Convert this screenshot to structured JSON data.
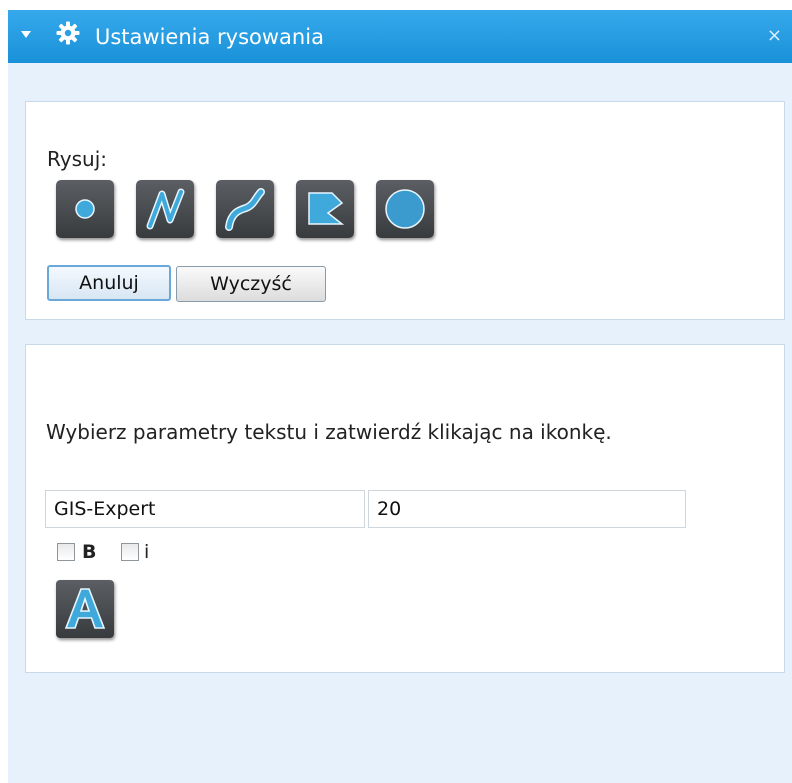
{
  "window": {
    "title": "Ustawienia rysowania",
    "close_label": "×",
    "icons": {
      "collapse": "triangle-down-icon",
      "gear": "gear-icon"
    }
  },
  "draw": {
    "label": "Rysuj:",
    "tools": [
      {
        "name": "point",
        "icon": "point-icon"
      },
      {
        "name": "polyline",
        "icon": "polyline-icon"
      },
      {
        "name": "freehand-line",
        "icon": "curve-icon"
      },
      {
        "name": "polygon",
        "icon": "polygon-icon"
      },
      {
        "name": "circle",
        "icon": "circle-icon"
      }
    ],
    "cancel_label": "Anuluj",
    "clear_label": "Wyczyść"
  },
  "text": {
    "instruction": "Wybierz parametry tekstu i zatwierdź klikając na ikonkę.",
    "text_value": "GIS-Expert",
    "size_value": "20",
    "bold_label": "B",
    "italic_label": "i",
    "bold_checked": false,
    "italic_checked": false,
    "tool_icon": "text-A-icon"
  },
  "colors": {
    "titlebar": "#1f9ae0",
    "panel_bg": "#e7f1fb",
    "tool_bg": "#44484c",
    "tool_accent": "#3fa9dc"
  }
}
